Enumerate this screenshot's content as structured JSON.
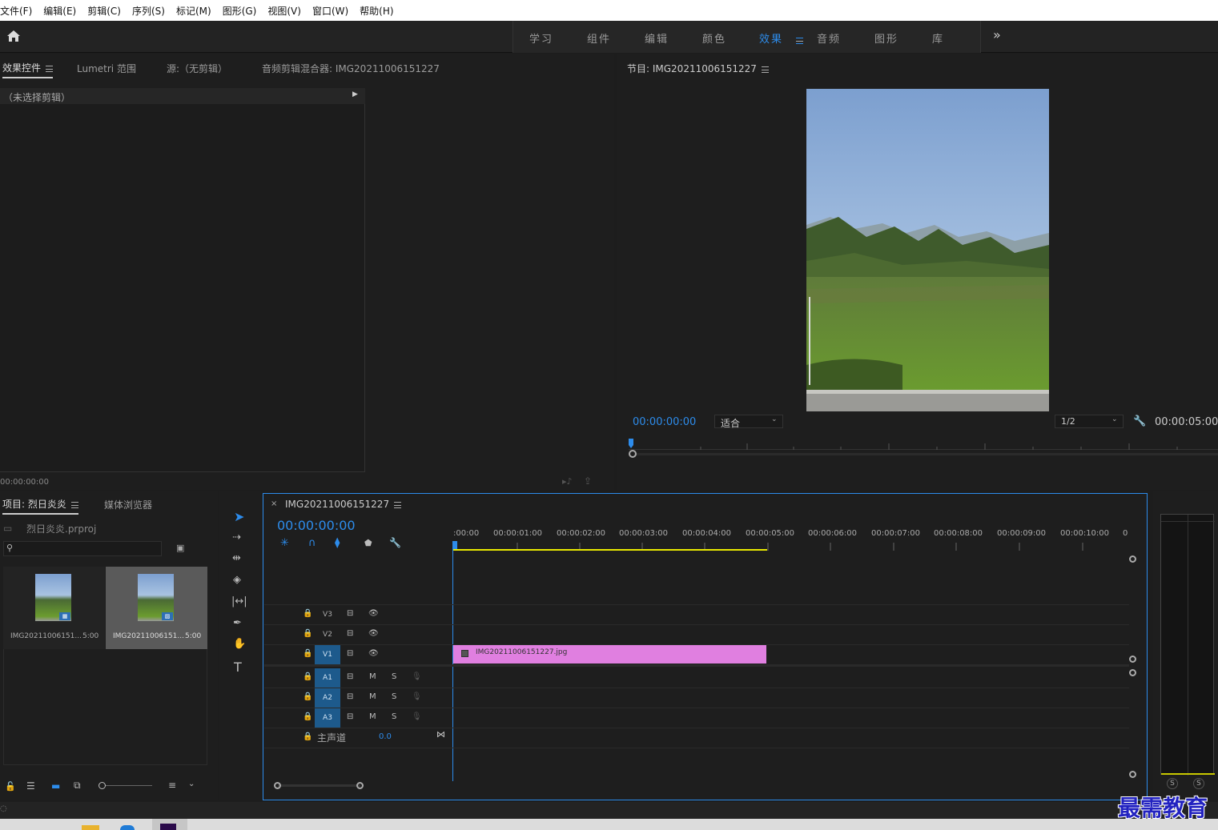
{
  "menu": [
    "文件(F)",
    "编辑(E)",
    "剪辑(C)",
    "序列(S)",
    "标记(M)",
    "图形(G)",
    "视图(V)",
    "窗口(W)",
    "帮助(H)"
  ],
  "workspaces": {
    "items": [
      "学习",
      "组件",
      "编辑",
      "颜色",
      "效果",
      "音频",
      "图形",
      "库"
    ],
    "active": "效果",
    "more": "»"
  },
  "source_panel": {
    "tabs": [
      "效果控件",
      "Lumetri 范围",
      "源:（无剪辑）",
      "音频剪辑混合器: IMG20211006151227"
    ],
    "no_clip": "（未选择剪辑）",
    "timecode": "00:00:00:00"
  },
  "program_monitor": {
    "title": "节目: IMG20211006151227",
    "timecode": "00:00:00:00",
    "fit": "适合",
    "resolution": "1/2",
    "duration": "00:00:05:00"
  },
  "project_panel": {
    "tabs": [
      "项目: 烈日炎炎",
      "媒体浏览器"
    ],
    "project_file": "烈日炎炎.prproj",
    "search_placeholder": "",
    "items": [
      {
        "name": "IMG20211006151...",
        "duration": "5:00"
      },
      {
        "name": "IMG20211006151...",
        "duration": "5:00"
      }
    ]
  },
  "timeline": {
    "tab": "IMG20211006151227",
    "timecode": "00:00:00:00",
    "ruler": [
      ":00:00",
      "00:00:01:00",
      "00:00:02:00",
      "00:00:03:00",
      "00:00:04:00",
      "00:00:05:00",
      "00:00:06:00",
      "00:00:07:00",
      "00:00:08:00",
      "00:00:09:00",
      "00:00:10:00",
      "0"
    ],
    "video_tracks": [
      "V3",
      "V2",
      "V1"
    ],
    "audio_tracks": [
      "A1",
      "A2",
      "A3"
    ],
    "master": "主声道",
    "master_value": "0.0",
    "mute": "M",
    "solo": "S",
    "clip": "IMG20211006151227.jpg"
  },
  "meter": {
    "s_left": "S",
    "s_right": "S"
  },
  "watermark": "最需教育",
  "colors": {
    "accent": "#2d8ceb",
    "clip": "#e07fe0",
    "track_on": "#1d5a8c"
  }
}
